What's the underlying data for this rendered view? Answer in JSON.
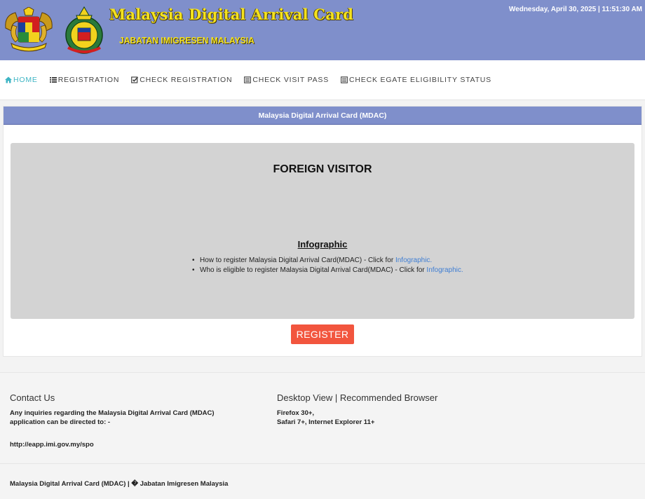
{
  "header": {
    "title": "Malaysia Digital Arrival Card",
    "subtitle": "JABATAN IMIGRESEN MALAYSIA",
    "datetime": "Wednesday, April 30, 2025 | 11:51:30 AM"
  },
  "nav": {
    "items": [
      {
        "label": "HOME",
        "icon": "home-icon"
      },
      {
        "label": "REGISTRATION",
        "icon": "list-icon"
      },
      {
        "label": "CHECK REGISTRATION",
        "icon": "check-square-icon"
      },
      {
        "label": "CHECK VISIT PASS",
        "icon": "document-icon"
      },
      {
        "label": "CHECK EGATE ELIGIBILITY STATUS",
        "icon": "document-icon"
      }
    ]
  },
  "panel": {
    "heading": "Malaysia Digital Arrival Card (MDAC)",
    "visitor_title": "FOREIGN VISITOR",
    "info_title": "Infographic",
    "info_items": [
      {
        "text": "How to register Malaysia Digital Arrival Card(MDAC) - Click for ",
        "link": "Infographic."
      },
      {
        "text": "Who is eligible to register Malaysia Digital Arrival Card(MDAC) - Click for ",
        "link": "Infographic."
      }
    ],
    "register_label": "REGISTER"
  },
  "footer": {
    "contact_heading": "Contact Us",
    "contact_text": "Any inquiries regarding the Malaysia Digital Arrival Card (MDAC) application can be directed to: -",
    "contact_link": "http://eapp.imi.gov.my/spo",
    "browser_heading": "Desktop View | Recommended Browser",
    "browser_line1": "Firefox 30+,",
    "browser_line2": "Safari 7+, Internet Explorer 11+",
    "copyright": "Malaysia Digital Arrival Card (MDAC) | � Jabatan Imigresen Malaysia"
  },
  "colors": {
    "header_bg": "#7f8fcb",
    "title_yellow": "#f4e21e",
    "nav_active": "#3fb5c4",
    "register_btn": "#f2553e",
    "link": "#3f7ed3"
  }
}
